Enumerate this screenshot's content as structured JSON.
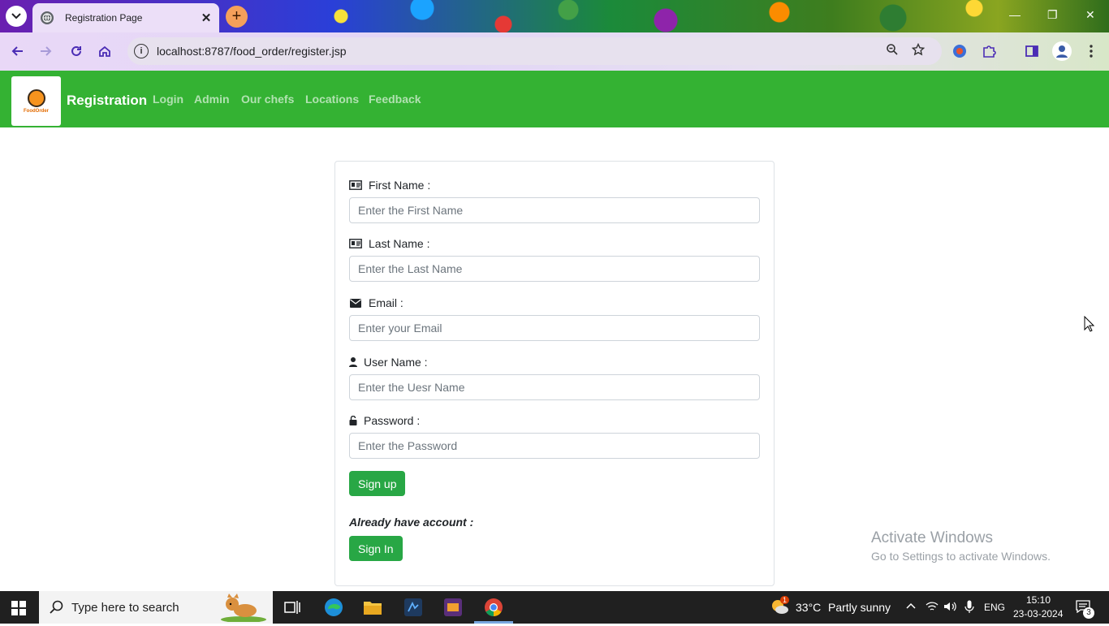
{
  "browser": {
    "tab_title": "Registration Page",
    "url": "localhost:8787/food_order/register.jsp"
  },
  "navbar": {
    "logo_text": "FoodOrder",
    "brand": "Registration",
    "links": [
      "Login",
      "Admin",
      "Our chefs",
      "Locations",
      "Feedback"
    ]
  },
  "form": {
    "first_name": {
      "label": "First Name :",
      "placeholder": "Enter the First Name"
    },
    "last_name": {
      "label": "Last Name :",
      "placeholder": "Enter the Last Name"
    },
    "email": {
      "label": "Email :",
      "placeholder": "Enter your Email"
    },
    "username": {
      "label": "User Name :",
      "placeholder": "Enter the Uesr Name"
    },
    "password": {
      "label": "Password :",
      "placeholder": "Enter the Password"
    },
    "signup_label": "Sign up",
    "already_text": "Already have account :",
    "signin_label": "Sign In"
  },
  "watermark": {
    "line1": "Activate Windows",
    "line2": "Go to Settings to activate Windows."
  },
  "taskbar": {
    "search_placeholder": "Type here to search",
    "weather_temp": "33°C",
    "weather_text": "Partly sunny",
    "language": "ENG",
    "time": "15:10",
    "date": "23-03-2024",
    "notification_count": "3",
    "weather_badge": "1"
  },
  "colors": {
    "navbar_green": "#34b233",
    "button_green": "#28a745"
  }
}
